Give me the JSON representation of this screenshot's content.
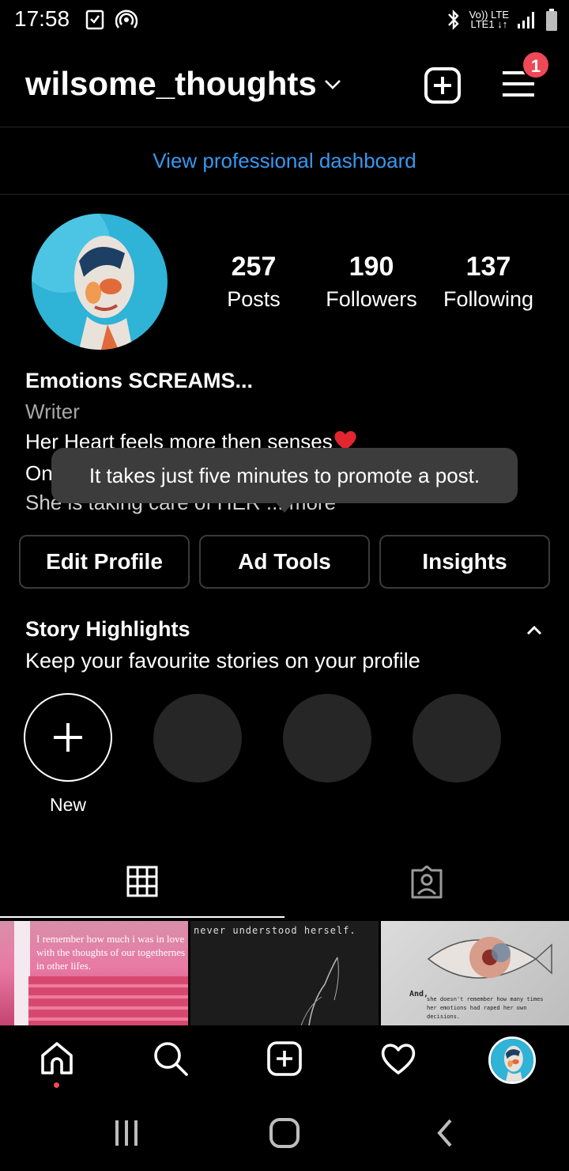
{
  "status_bar": {
    "time": "17:58",
    "net_top": "Vo)) LTE",
    "net_bottom": "LTE1 ↓↑"
  },
  "header": {
    "username": "wilsome_thoughts",
    "notification_count": "1"
  },
  "dashboard_link": "View professional dashboard",
  "stats": {
    "posts": {
      "value": "257",
      "label": "Posts"
    },
    "followers": {
      "value": "190",
      "label": "Followers"
    },
    "following": {
      "value": "137",
      "label": "Following"
    }
  },
  "bio": {
    "name": "Emotions SCREAMS...",
    "category": "Writer",
    "line1": "Her Heart feels more then senses",
    "line2_visible": "On",
    "line3_visible": "She is taking care of HER ... more"
  },
  "tooltip": "It takes just five minutes to promote a post.",
  "profile_buttons": {
    "edit": "Edit Profile",
    "ad_tools": "Ad Tools",
    "insights": "Insights"
  },
  "highlights": {
    "title": "Story Highlights",
    "subtitle": "Keep your favourite stories on your profile",
    "new_label": "New"
  },
  "thumbnails": [
    {
      "text": "I remember how much i was in love with the thoughts of our togethernes in other lifes."
    },
    {
      "text": "never understood herself."
    },
    {
      "text_a": "And,",
      "text_b": "she doesn't remember how many times her emotions had raped her own decisions."
    }
  ],
  "colors": {
    "link_blue": "#3897f0",
    "badge_red": "#ed4956",
    "tooltip_bg": "#3c3c3c"
  }
}
